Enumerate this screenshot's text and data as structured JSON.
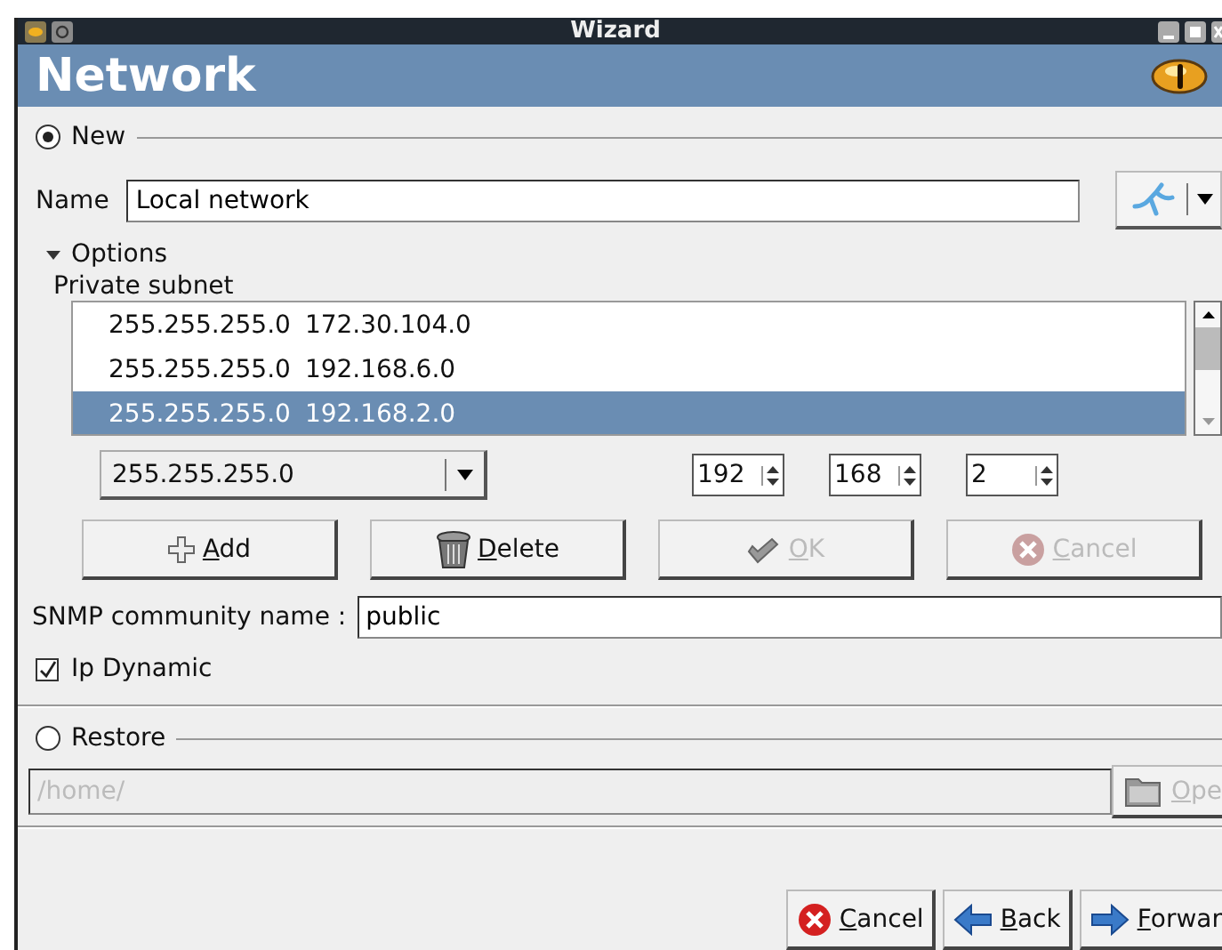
{
  "window": {
    "title": "Wizard"
  },
  "header": {
    "title": "Network"
  },
  "new_section": {
    "label": "New",
    "selected": true
  },
  "name": {
    "label": "Name",
    "value": "Local network"
  },
  "options": {
    "label": "Options",
    "expanded": true
  },
  "subnet": {
    "label": "Private subnet",
    "rows": [
      {
        "mask": "255.255.255.0",
        "network": "172.30.104.0",
        "selected": false
      },
      {
        "mask": "255.255.255.0",
        "network": "192.168.6.0",
        "selected": false
      },
      {
        "mask": "255.255.255.0",
        "network": "192.168.2.0",
        "selected": true
      }
    ]
  },
  "mask_combo": {
    "value": "255.255.255.0"
  },
  "octets": [
    "192",
    "168",
    "2"
  ],
  "list_buttons": [
    {
      "label": "Add",
      "kind": "add",
      "disabled": false
    },
    {
      "label": "Delete",
      "kind": "delete",
      "disabled": false
    },
    {
      "label": "OK",
      "kind": "ok",
      "disabled": true
    },
    {
      "label": "Cancel",
      "kind": "cancel",
      "disabled": true
    }
  ],
  "snmp": {
    "label": "SNMP community name :",
    "value": "public"
  },
  "ip_dynamic": {
    "label": "Ip Dynamic",
    "checked": true
  },
  "restore": {
    "label": "Restore",
    "selected": false,
    "path": "/home/",
    "disabled": true,
    "open_label": "Ope"
  },
  "footer_buttons": [
    {
      "label": "Cancel",
      "kind": "cancel"
    },
    {
      "label": "Back",
      "kind": "back"
    },
    {
      "label": "Forwar",
      "kind": "forward"
    }
  ]
}
